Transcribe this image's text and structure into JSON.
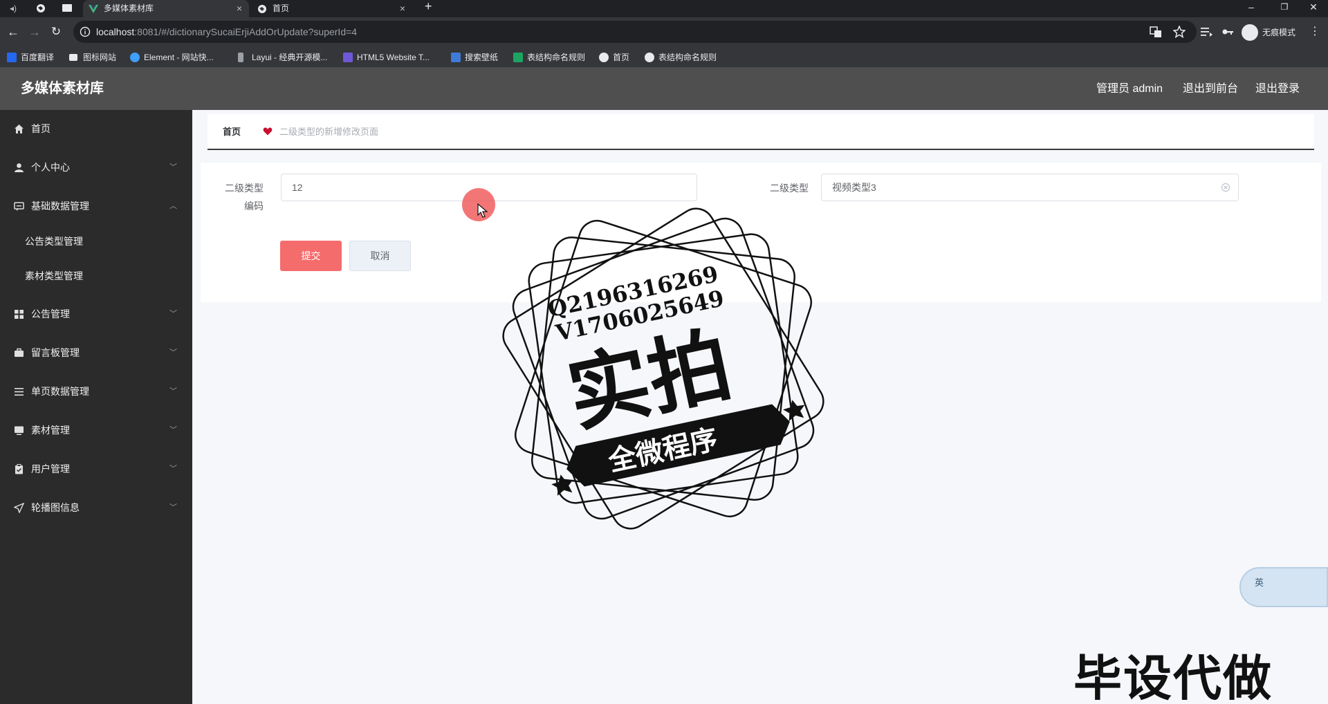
{
  "browser": {
    "tabs": [
      {
        "title": "多媒体素材库",
        "active": true
      },
      {
        "title": "首页",
        "active": false
      }
    ],
    "new_tab_glyph": "+",
    "close_glyph": "×",
    "url_host": "localhost",
    "url_rest": ":8081/#/dictionarySucaiErjiAddOrUpdate?superId=4",
    "incognito_label": "无痕模式",
    "bookmarks": [
      {
        "label": "百度翻译",
        "color": "#2468f2"
      },
      {
        "label": "图标网站",
        "color": "#e8eaed"
      },
      {
        "label": "Element - 网站快...",
        "color": "#409eff"
      },
      {
        "label": "Layui - 经典开源模...",
        "color": "#9aa0a6"
      },
      {
        "label": "HTML5 Website T...",
        "color": "#6f58d8"
      },
      {
        "label": "搜索壁纸",
        "color": "#3f7bd9"
      },
      {
        "label": "表结构命名规则",
        "color": "#1da462"
      },
      {
        "label": "首页",
        "color": "#e8eaed"
      },
      {
        "label": "表结构命名规则",
        "color": "#e8eaed"
      }
    ]
  },
  "header": {
    "title": "多媒体素材库",
    "admin_label": "管理员 admin",
    "front_label": "退出到前台",
    "logout_label": "退出登录"
  },
  "sidebar": {
    "items": [
      {
        "label": "首页",
        "icon": "home-icon",
        "has_children": false
      },
      {
        "label": "个人中心",
        "icon": "user-icon",
        "has_children": true
      },
      {
        "label": "基础数据管理",
        "icon": "chat-icon",
        "has_children": true,
        "expanded": true,
        "children": [
          "公告类型管理",
          "素材类型管理"
        ]
      },
      {
        "label": "公告管理",
        "icon": "grid-icon",
        "has_children": true
      },
      {
        "label": "留言板管理",
        "icon": "briefcase-icon",
        "has_children": true
      },
      {
        "label": "单页数据管理",
        "icon": "list-icon",
        "has_children": true
      },
      {
        "label": "素材管理",
        "icon": "monitor-icon",
        "has_children": true
      },
      {
        "label": "用户管理",
        "icon": "clipboard-icon",
        "has_children": true
      },
      {
        "label": "轮播图信息",
        "icon": "send-icon",
        "has_children": true
      }
    ]
  },
  "breadcrumb": {
    "home": "首页",
    "page": "二级类型的新增修改页面"
  },
  "form": {
    "code_label_line1": "二级类型",
    "code_label_line2": "编码",
    "code_value": "12",
    "name_label": "二级类型",
    "name_value": "视频类型3",
    "submit_label": "提交",
    "cancel_label": "取消"
  },
  "overlay": {
    "stamp_line1": "Q2196316269",
    "stamp_line2": "V1706025649",
    "stamp_big": "实拍",
    "stamp_banner": "全微程序",
    "watermark": "毕设代做",
    "ime_label": "英"
  },
  "colors": {
    "header_bg": "#4f4f4f",
    "sidebar_bg": "#2b2b2b",
    "submit_bg": "#f56c6c",
    "breadcrumb_heart": "#c8102e"
  }
}
